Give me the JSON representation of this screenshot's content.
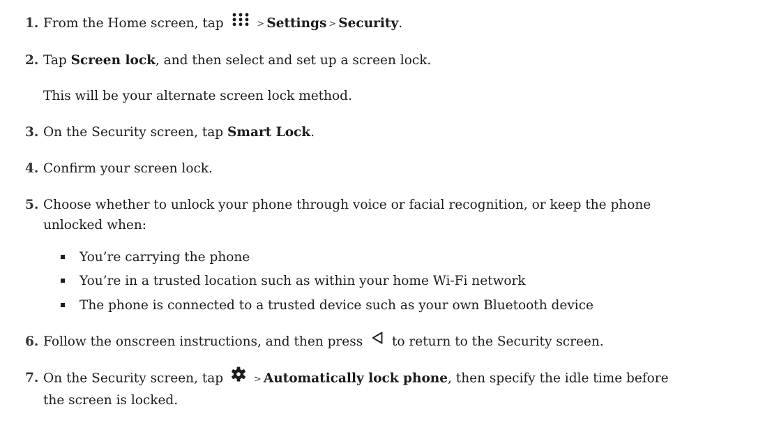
{
  "steps": [
    {
      "number": "1.",
      "pre": "From the Home screen, tap",
      "icon": "apps-grid-icon",
      "sep1": ">",
      "b1": "Settings",
      "sep2": ">",
      "b2": "Security",
      "post": "."
    },
    {
      "number": "2.",
      "pre": "Tap ",
      "b1": "Screen lock",
      "post": ", and then select and set up a screen lock.",
      "note": "This will be your alternate screen lock method."
    },
    {
      "number": "3.",
      "pre": "On the Security screen, tap ",
      "b1": "Smart Lock",
      "post": "."
    },
    {
      "number": "4.",
      "text": "Confirm your screen lock."
    },
    {
      "number": "5.",
      "line1": "Choose whether to unlock your phone through voice or facial recognition, or keep the phone",
      "line2": "unlocked when:",
      "bullets": [
        "You’re carrying the phone",
        "You’re in a trusted location such as within your home Wi-Fi network",
        "The phone is connected to a trusted device such as your own Bluetooth device"
      ]
    },
    {
      "number": "6.",
      "pre": "Follow the onscreen instructions, and then press",
      "icon": "back-triangle-icon",
      "post": "to return to the Security screen."
    },
    {
      "number": "7.",
      "pre": "On the Security screen, tap",
      "icon": "gear-icon",
      "sep1": ">",
      "b1": "Automatically lock phone",
      "post": ", then specify the idle time before",
      "line2": "the screen is locked."
    }
  ]
}
